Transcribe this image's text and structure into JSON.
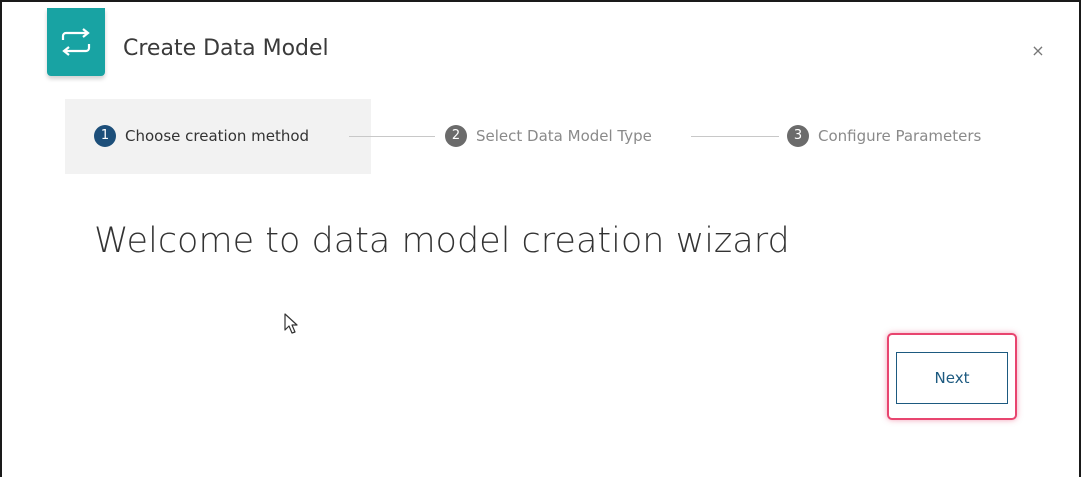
{
  "dialog": {
    "title": "Create Data Model",
    "close_symbol": "×",
    "icon": "sync-arrows-icon",
    "accent_color": "#18a3a3"
  },
  "stepper": {
    "steps": [
      {
        "number": "1",
        "label": "Choose creation method",
        "state": "active"
      },
      {
        "number": "2",
        "label": "Select Data Model Type",
        "state": "inactive"
      },
      {
        "number": "3",
        "label": "Configure Parameters",
        "state": "inactive"
      }
    ],
    "active_color": "#1d4f7a",
    "inactive_color": "#6b6b6b",
    "inactive_text_color": "#8a8a8a"
  },
  "main": {
    "heading": "Welcome to data model creation wizard"
  },
  "footer": {
    "next_label": "Next",
    "highlight_color": "#e8456f"
  }
}
